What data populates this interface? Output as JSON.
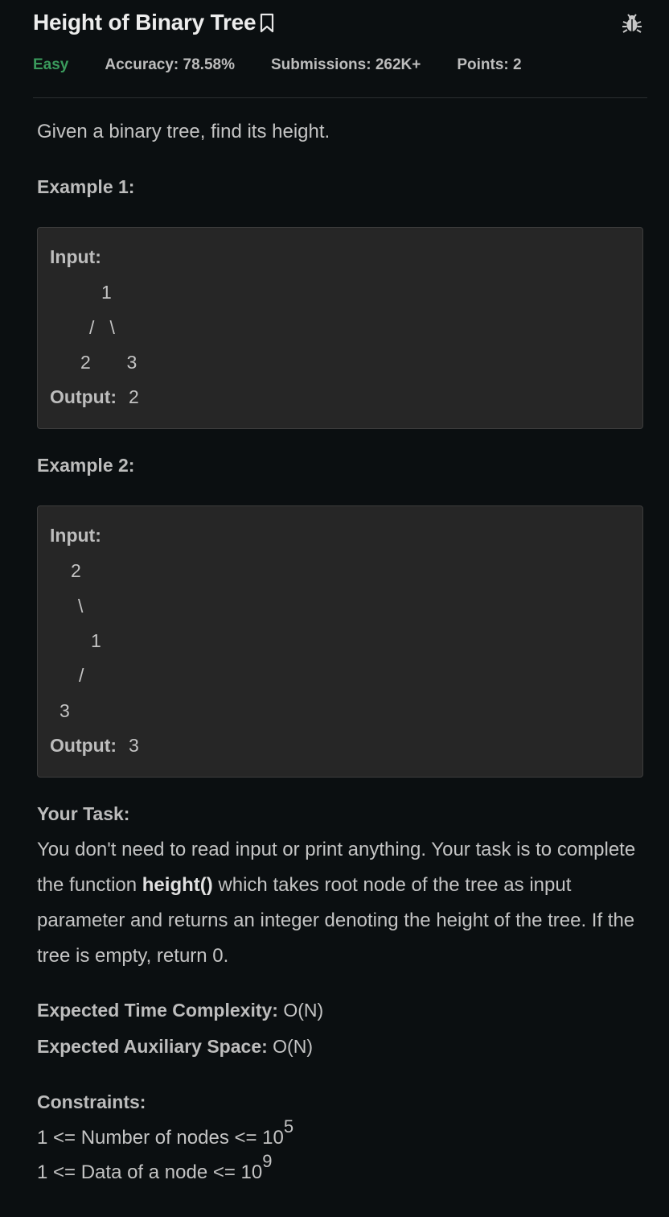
{
  "header": {
    "title": "Height of Binary Tree",
    "difficulty": "Easy",
    "accuracy": "Accuracy: 78.58%",
    "submissions": "Submissions: 262K+",
    "points": "Points: 2",
    "icons": [
      "bookmark-icon",
      "bug-icon"
    ]
  },
  "description": "Given a binary tree, find its height.",
  "examples": [
    {
      "label": "Example 1:",
      "input_label": "Input:",
      "tree_lines": [
        "1",
        "/   \\",
        "2       3"
      ],
      "output_label": "Output:",
      "output_value": "2"
    },
    {
      "label": "Example 2:",
      "input_label": "Input:",
      "tree_lines": [
        "2",
        "\\",
        "1",
        "/",
        "3"
      ],
      "output_label": "Output:",
      "output_value": "3"
    }
  ],
  "task": {
    "heading": "Your Task:",
    "text_before": "You don't need to read input or print anything. Your task is to complete the function ",
    "function_name": "height()",
    "text_after": " which takes root node of the tree as input parameter and returns an integer denoting the height of the tree. If the tree is empty, return 0."
  },
  "complexity": {
    "time_label": "Expected Time Complexity:",
    "time_value": "O(N)",
    "space_label": "Expected Auxiliary Space:",
    "space_value": "O(N)"
  },
  "constraints": {
    "heading": "Constraints:",
    "line1_base": "1 <= Number of nodes <= 10",
    "line1_exp": "5",
    "line2_base": "1 <= Data of a node <= 10",
    "line2_exp": "9"
  },
  "colors": {
    "background": "#0b0f11",
    "difficulty_easy": "#3a9a5c",
    "box_background": "#262626"
  }
}
